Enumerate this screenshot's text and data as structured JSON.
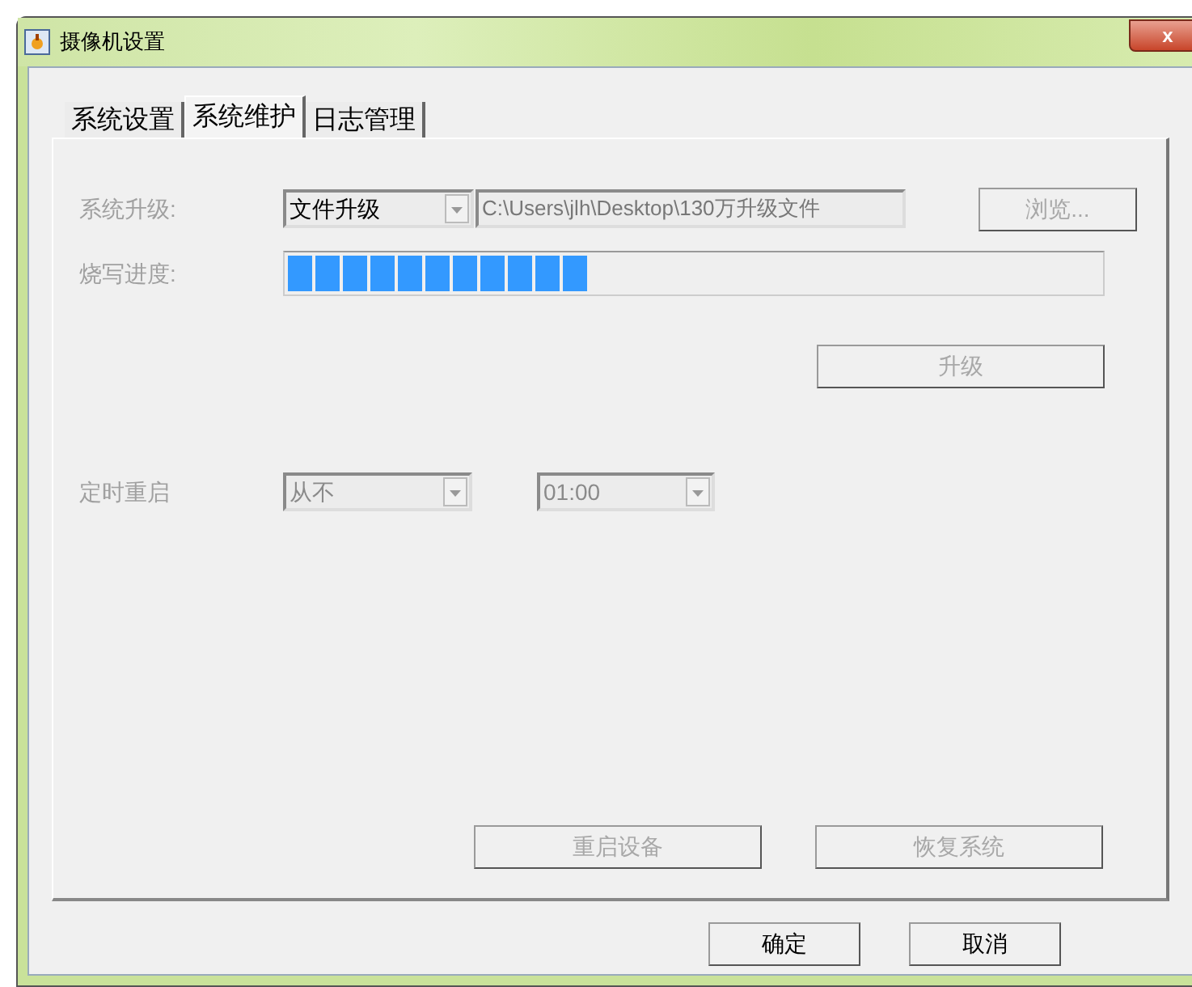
{
  "window": {
    "title": "摄像机设置",
    "close": "x"
  },
  "tabs": [
    {
      "label": "系统设置",
      "selected": false
    },
    {
      "label": "系统维护",
      "selected": true
    },
    {
      "label": "日志管理",
      "selected": false
    }
  ],
  "upgrade": {
    "label": "系统升级:",
    "mode": "文件升级",
    "path": "C:\\Users\\jlh\\Desktop\\130万升级文件",
    "browse": "浏览...",
    "disabled": true
  },
  "progress": {
    "label": "烧写进度:",
    "level": 0.37
  },
  "upgrade_button": {
    "label": "升级",
    "disabled": true
  },
  "reboot": {
    "label": "定时重启",
    "frequency": "从不",
    "time": "01:00",
    "disabled": true
  },
  "actions": [
    {
      "label": "重启设备",
      "disabled": true
    },
    {
      "label": "恢复系统",
      "disabled": true
    }
  ],
  "buttons": [
    {
      "label": "确定",
      "disabled": false
    },
    {
      "label": "取消",
      "disabled": false
    }
  ]
}
